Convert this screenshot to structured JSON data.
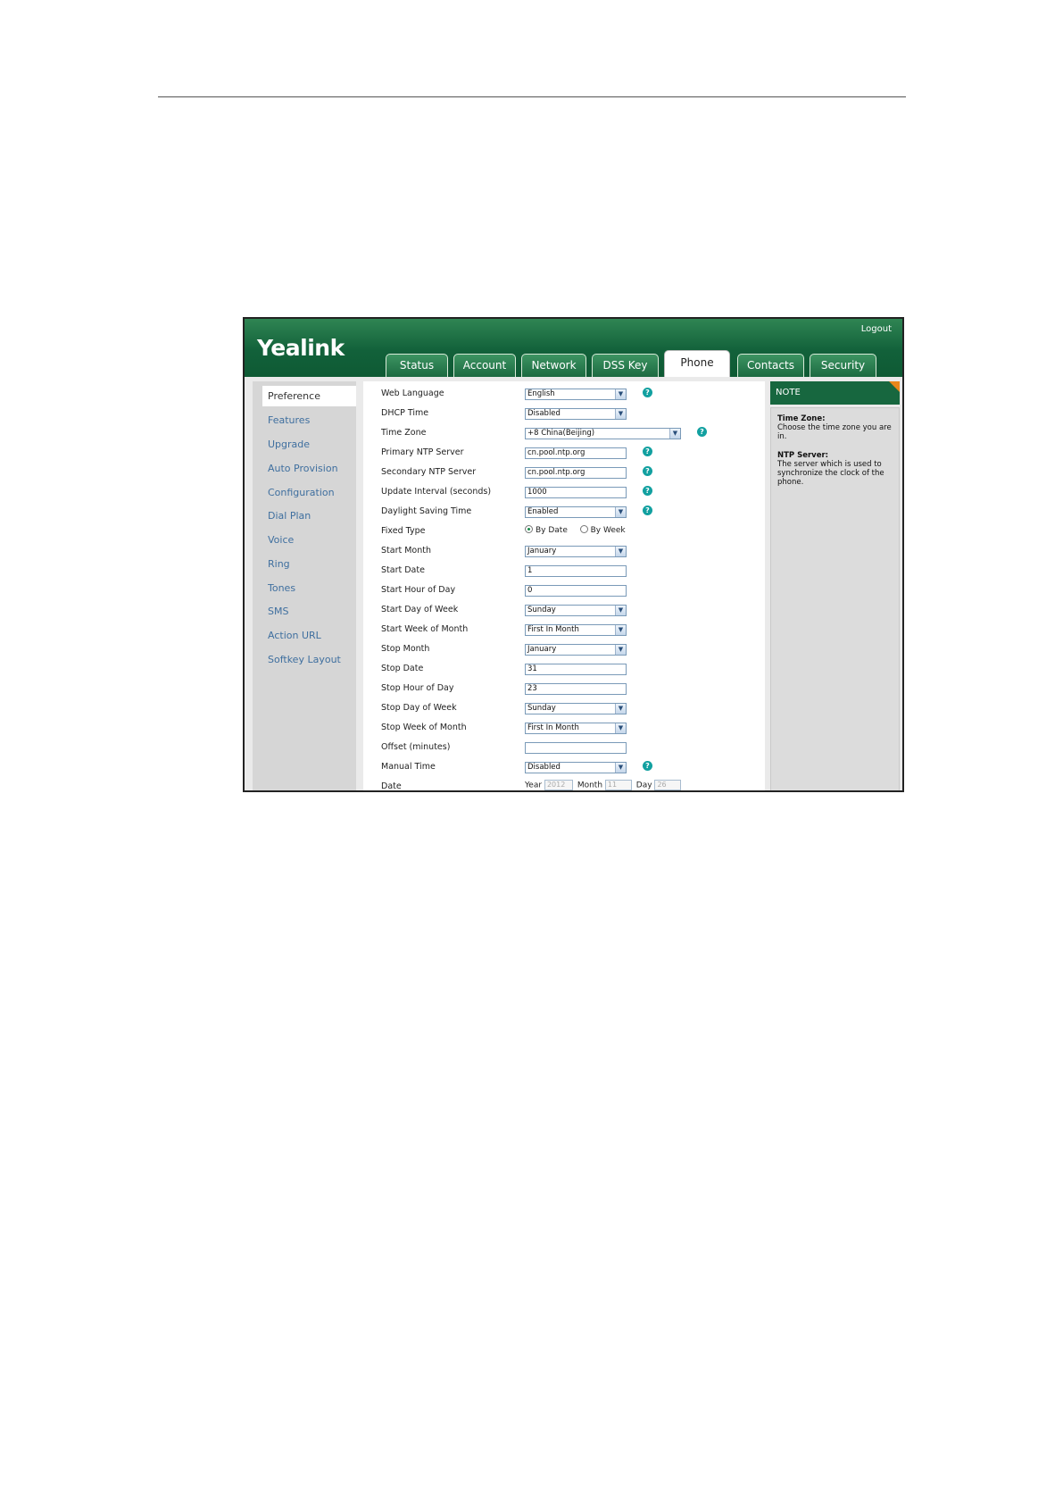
{
  "header": {
    "logo": "Yealink",
    "logout": "Logout"
  },
  "tabs": [
    {
      "label": "Status",
      "active": false
    },
    {
      "label": "Account",
      "active": false
    },
    {
      "label": "Network",
      "active": false
    },
    {
      "label": "DSS Key",
      "active": false
    },
    {
      "label": "Phone",
      "active": true
    },
    {
      "label": "Contacts",
      "active": false
    },
    {
      "label": "Security",
      "active": false
    }
  ],
  "sidebar": {
    "items": [
      "Preference",
      "Features",
      "Upgrade",
      "Auto Provision",
      "Configuration",
      "Dial Plan",
      "Voice",
      "Ring",
      "Tones",
      "SMS",
      "Action URL",
      "Softkey Layout"
    ],
    "active": "Preference"
  },
  "form": {
    "web_language": {
      "label": "Web Language",
      "value": "English"
    },
    "dhcp_time": {
      "label": "DHCP Time",
      "value": "Disabled"
    },
    "time_zone": {
      "label": "Time Zone",
      "value": "+8 China(Beijing)"
    },
    "primary_ntp": {
      "label": "Primary NTP Server",
      "value": "cn.pool.ntp.org"
    },
    "secondary_ntp": {
      "label": "Secondary NTP Server",
      "value": "cn.pool.ntp.org"
    },
    "update_interval": {
      "label": "Update Interval (seconds)",
      "value": "1000"
    },
    "daylight_saving": {
      "label": "Daylight Saving Time",
      "value": "Enabled"
    },
    "fixed_type": {
      "label": "Fixed Type",
      "option_date": "By Date",
      "option_week": "By Week",
      "selected": "By Date"
    },
    "start_month": {
      "label": "Start Month",
      "value": "January"
    },
    "start_date": {
      "label": "Start Date",
      "value": "1"
    },
    "start_hour": {
      "label": "Start Hour of Day",
      "value": "0"
    },
    "start_day_week": {
      "label": "Start Day of Week",
      "value": "Sunday"
    },
    "start_week_month": {
      "label": "Start Week of Month",
      "value": "First In Month"
    },
    "stop_month": {
      "label": "Stop Month",
      "value": "January"
    },
    "stop_date": {
      "label": "Stop Date",
      "value": "31"
    },
    "stop_hour": {
      "label": "Stop Hour of Day",
      "value": "23"
    },
    "stop_day_week": {
      "label": "Stop Day of Week",
      "value": "Sunday"
    },
    "stop_week_month": {
      "label": "Stop Week of Month",
      "value": "First In Month"
    },
    "offset": {
      "label": "Offset (minutes)",
      "value": ""
    },
    "manual_time": {
      "label": "Manual Time",
      "value": "Disabled"
    },
    "date": {
      "label": "Date",
      "year_label": "Year",
      "year": "2012",
      "month_label": "Month",
      "month": "11",
      "day_label": "Day",
      "day": "26"
    }
  },
  "note": {
    "title": "NOTE",
    "time_zone_title": "Time Zone:",
    "time_zone_desc": "Choose the time zone you are in.",
    "ntp_title": "NTP Server:",
    "ntp_desc": "The server which is used to synchronize the clock of the phone."
  },
  "colors": {
    "brand_green": "#17673f",
    "link_blue": "#3f6f9f",
    "note_corner": "#e8861a",
    "help": "#12a0a0"
  },
  "icons": {
    "help": "question-circle-icon",
    "dropdown": "chevron-down-icon"
  }
}
